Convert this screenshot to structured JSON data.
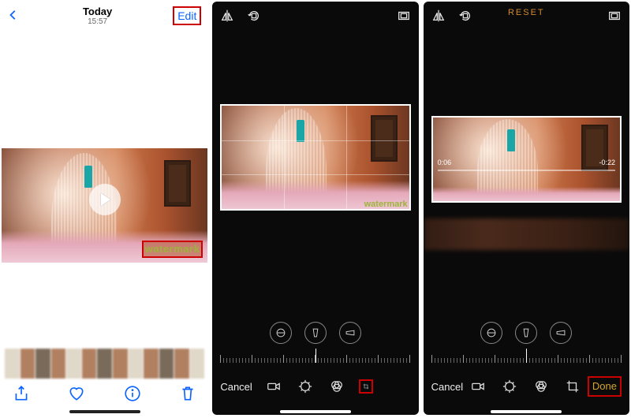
{
  "panel1": {
    "title": "Today",
    "subtitle": "15:57",
    "edit": "Edit",
    "watermark": "watermark"
  },
  "panel2": {
    "watermark": "watermark",
    "cancel": "Cancel"
  },
  "panel3": {
    "reset": "RESET",
    "time_start": "0:06",
    "time_end": "-0:22",
    "cancel": "Cancel",
    "done": "Done"
  },
  "icons": {
    "back": "chevron-left",
    "share": "share",
    "heart": "heart",
    "info": "info",
    "trash": "trash",
    "flip_h": "flip-horizontal",
    "rotate": "rotate",
    "aspect": "aspect-frames",
    "straighten": "straighten",
    "skew_h": "skew-horizontal",
    "skew_v": "skew-vertical",
    "video": "video-camera",
    "adjust": "adjust",
    "filters": "filters",
    "crop": "crop"
  },
  "colors": {
    "ios_blue": "#0b63ff",
    "hl_red": "#cc0000",
    "ios_orange": "#d68a2e",
    "done_yellow": "#d6a52e"
  }
}
